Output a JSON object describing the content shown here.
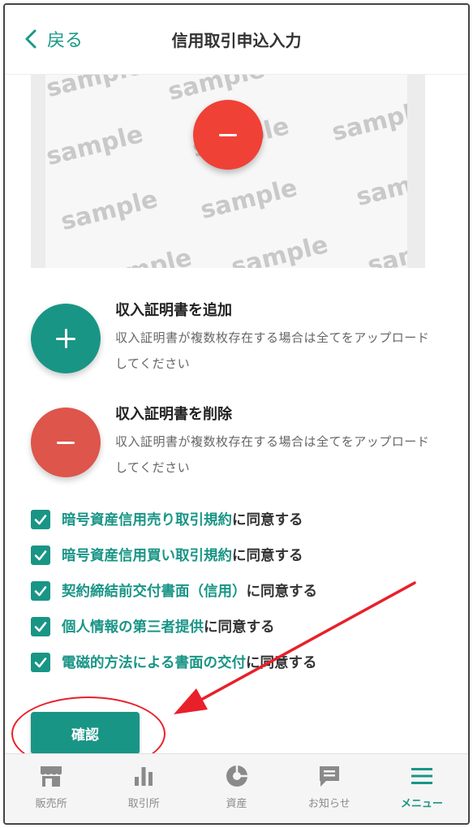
{
  "header": {
    "back_label": "戻る",
    "title": "信用取引申込入力"
  },
  "sample_image": {
    "watermark_text": "sample",
    "remove_icon": "minus-icon"
  },
  "actions": [
    {
      "name": "add",
      "title": "収入証明書を追加",
      "description": "収入証明書が複数枚存在する場合は全てをアップロードしてください",
      "icon": "plus-icon"
    },
    {
      "name": "remove",
      "title": "収入証明書を削除",
      "description": "収入証明書が複数枚存在する場合は全てをアップロードしてください",
      "icon": "minus-icon"
    }
  ],
  "agreements": [
    {
      "link": "暗号資産信用売り取引規約",
      "rest": "に同意する",
      "checked": true
    },
    {
      "link": "暗号資産信用買い取引規約",
      "rest": "に同意する",
      "checked": true
    },
    {
      "link": "契約締結前交付書面（信用）",
      "rest": "に同意する",
      "checked": true
    },
    {
      "link": "個人情報の第三者提供",
      "rest": "に同意する",
      "checked": true
    },
    {
      "link": "電磁的方法による書面の交付",
      "rest": "に同意する",
      "checked": true
    }
  ],
  "confirm_label": "確認",
  "nav": {
    "items": [
      {
        "label": "販売所",
        "icon": "store-icon"
      },
      {
        "label": "取引所",
        "icon": "bar-chart-icon"
      },
      {
        "label": "資産",
        "icon": "pie-chart-icon"
      },
      {
        "label": "お知らせ",
        "icon": "message-icon"
      },
      {
        "label": "メニュー",
        "icon": "menu-icon",
        "active": true
      }
    ]
  },
  "colors": {
    "accent": "#199586",
    "danger": "#ef4136",
    "annotation": "#e8202a"
  }
}
